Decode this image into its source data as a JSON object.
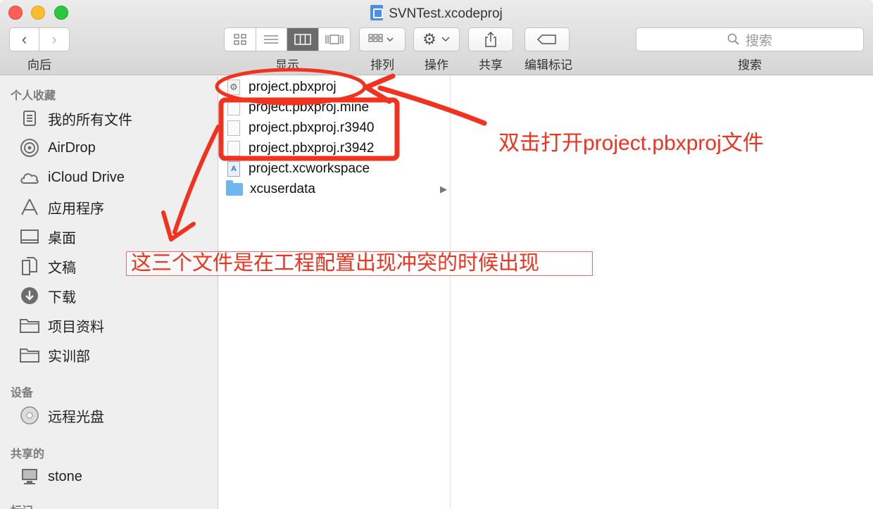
{
  "window": {
    "title": "SVNTest.xcodeproj"
  },
  "toolbar": {
    "back_label": "向后",
    "view_label": "显示",
    "arrange_label": "排列",
    "action_label": "操作",
    "share_label": "共享",
    "tags_label": "编辑标记",
    "search_label": "搜索",
    "search_placeholder": "搜索"
  },
  "sidebar": {
    "favorites_header": "个人收藏",
    "favorites": [
      {
        "label": "我的所有文件",
        "icon": "all-files-icon"
      },
      {
        "label": "AirDrop",
        "icon": "airdrop-icon"
      },
      {
        "label": "iCloud Drive",
        "icon": "cloud-icon"
      },
      {
        "label": "应用程序",
        "icon": "applications-icon"
      },
      {
        "label": "桌面",
        "icon": "desktop-icon"
      },
      {
        "label": "文稿",
        "icon": "documents-icon"
      },
      {
        "label": "下载",
        "icon": "download-icon"
      },
      {
        "label": "项目资料",
        "icon": "folder-icon"
      },
      {
        "label": "实训部",
        "icon": "folder-icon"
      }
    ],
    "devices_header": "设备",
    "devices": [
      {
        "label": "远程光盘",
        "icon": "disc-icon"
      }
    ],
    "shared_header": "共享的",
    "shared": [
      {
        "label": "stone",
        "icon": "computer-icon"
      }
    ],
    "tags_header": "标记"
  },
  "column": {
    "files": [
      {
        "name": "project.pbxproj",
        "icon": "gear-doc-icon"
      },
      {
        "name": "project.pbxproj.mine",
        "icon": "document-icon"
      },
      {
        "name": "project.pbxproj.r3940",
        "icon": "document-icon"
      },
      {
        "name": "project.pbxproj.r3942",
        "icon": "document-icon"
      },
      {
        "name": "project.xcworkspace",
        "icon": "workspace-icon"
      },
      {
        "name": "xcuserdata",
        "icon": "folder-icon"
      }
    ]
  },
  "annotations": {
    "open_hint": "双击打开project.pbxproj文件",
    "conflict_hint": "这三个文件是在工程配置出现冲突的时候出现"
  },
  "colors": {
    "annotation_red": "#f0321e",
    "sidebar_bg": "#efefef",
    "folder_blue": "#6fb6f0"
  }
}
